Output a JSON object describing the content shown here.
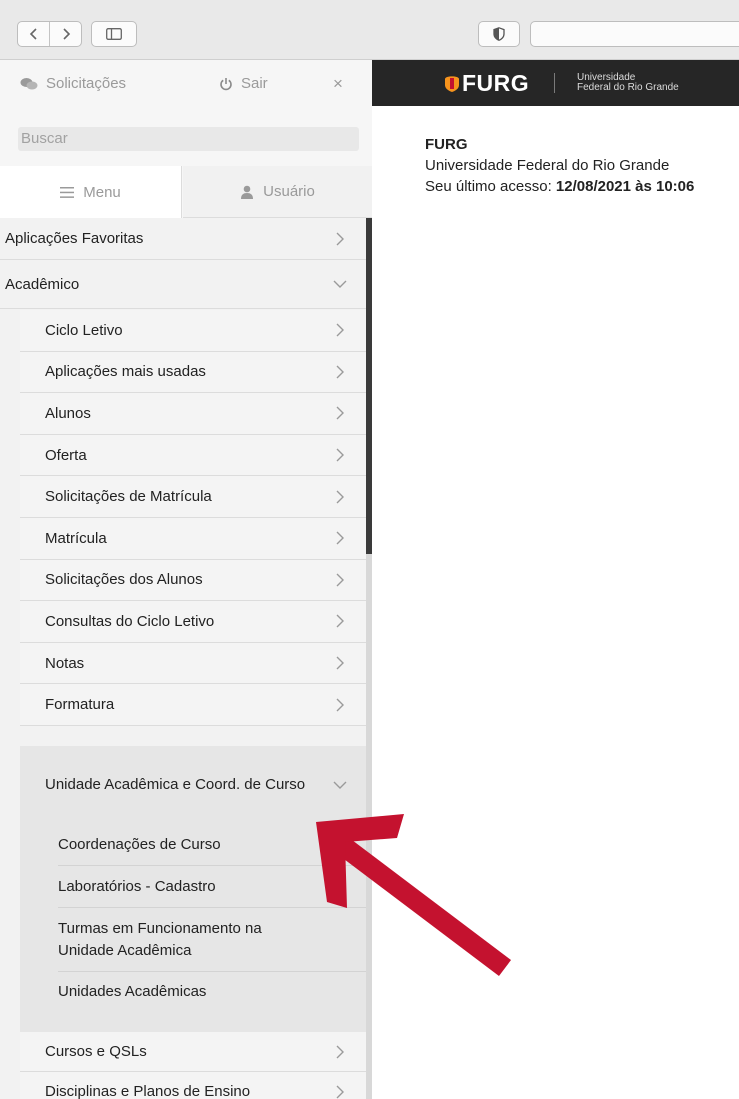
{
  "sidebar": {
    "requests_label": "Solicitações",
    "logout_label": "Sair",
    "close_symbol": "×",
    "search_placeholder": "Buscar",
    "tabs": {
      "menu": "Menu",
      "user": "Usuário"
    },
    "items": {
      "favorites": "Aplicações Favoritas",
      "academic": "Acadêmico",
      "academic_children": [
        "Ciclo Letivo",
        "Aplicações mais usadas",
        "Alunos",
        "Oferta",
        "Solicitações de Matrícula",
        "Matrícula",
        "Solicitações dos Alunos",
        "Consultas do Ciclo Letivo",
        "Notas",
        "Formatura"
      ],
      "unit_group": {
        "label": "Unidade Acadêmica e Coord. de Curso",
        "children": [
          "Coordenações de Curso",
          "Laboratórios - Cadastro",
          "Turmas em Funcionamento na Unidade Acadêmica",
          "Unidades Acadêmicas"
        ]
      },
      "after": [
        "Cursos e QSLs",
        "Disciplinas e Planos de Ensino"
      ]
    }
  },
  "banner": {
    "logo": "FURG",
    "subtitle_line1": "Universidade",
    "subtitle_line2": "Federal do Rio Grande"
  },
  "main": {
    "institution": "FURG",
    "full_name": "Universidade Federal do Rio Grande",
    "last_access_label": "Seu último acesso:",
    "last_access_value": "12/08/2021 às 10:06"
  },
  "colors": {
    "arrow": "#c4122f",
    "banner": "#262626",
    "logo_accent": "#f7941d"
  },
  "icons": [
    "chevron-left-icon",
    "chevron-right-icon",
    "sidebar-icon",
    "shield-icon",
    "chat-icon",
    "power-icon",
    "close-icon",
    "menu-icon",
    "user-icon",
    "chevron-down-icon"
  ]
}
